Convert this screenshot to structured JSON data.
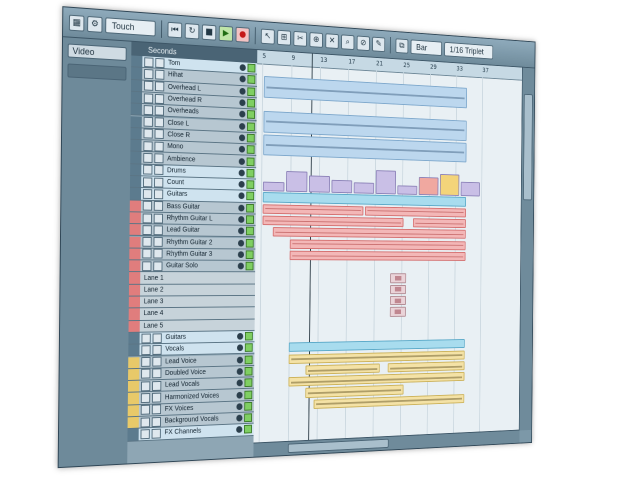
{
  "toolbar": {
    "mode": "Touch",
    "snap_label": "Bar",
    "quantize": "1/16 Triplet"
  },
  "inspector": {
    "preset": "Video"
  },
  "tracklist": {
    "header": "Seconds",
    "tracks": [
      {
        "name": "Tom",
        "kind": "folder"
      },
      {
        "name": "Hihat",
        "kind": "drum"
      },
      {
        "name": "Overhead L",
        "kind": "drum"
      },
      {
        "name": "Overhead R",
        "kind": "drum"
      },
      {
        "name": "Overheads",
        "kind": "drum"
      },
      {
        "name": "Close L",
        "kind": "drum"
      },
      {
        "name": "Close R",
        "kind": "drum"
      },
      {
        "name": "Mono",
        "kind": "drum"
      },
      {
        "name": "Ambience",
        "kind": "drum"
      },
      {
        "name": "Drums",
        "kind": "folder"
      },
      {
        "name": "Count",
        "kind": "folder"
      },
      {
        "name": "Guitars",
        "kind": "folder"
      },
      {
        "name": "Bass Guitar",
        "kind": "red"
      },
      {
        "name": "Rhythm Guitar L",
        "kind": "red"
      },
      {
        "name": "Lead Guitar",
        "kind": "red"
      },
      {
        "name": "Rhythm Guitar 2",
        "kind": "red"
      },
      {
        "name": "Rhythm Guitar 3",
        "kind": "red"
      },
      {
        "name": "Guitar Solo",
        "kind": "red"
      },
      {
        "name": "Lane 1",
        "kind": "lane"
      },
      {
        "name": "Lane 2",
        "kind": "lane"
      },
      {
        "name": "Lane 3",
        "kind": "lane"
      },
      {
        "name": "Lane 4",
        "kind": "lane"
      },
      {
        "name": "Lane 5",
        "kind": "lane"
      },
      {
        "name": "Guitars",
        "kind": "folder"
      },
      {
        "name": "Vocals",
        "kind": "folder"
      },
      {
        "name": "Lead Voice",
        "kind": "yellow"
      },
      {
        "name": "Doubled Voice",
        "kind": "yellow"
      },
      {
        "name": "Lead Vocals",
        "kind": "yellow"
      },
      {
        "name": "Harmonized Voices",
        "kind": "yellow"
      },
      {
        "name": "FX Voices",
        "kind": "yellow"
      },
      {
        "name": "Background Vocals",
        "kind": "yellow"
      },
      {
        "name": "FX Channels",
        "kind": "folder"
      }
    ]
  },
  "ruler": {
    "labels": [
      "5",
      "9",
      "13",
      "17",
      "21",
      "25",
      "29",
      "33",
      "37"
    ]
  },
  "colors": {
    "drums_event": "#bcd7ee",
    "guitar_event": "#f3b7b7",
    "vocal_event": "#f4e2a6",
    "folder_event": "#a8dcee"
  }
}
